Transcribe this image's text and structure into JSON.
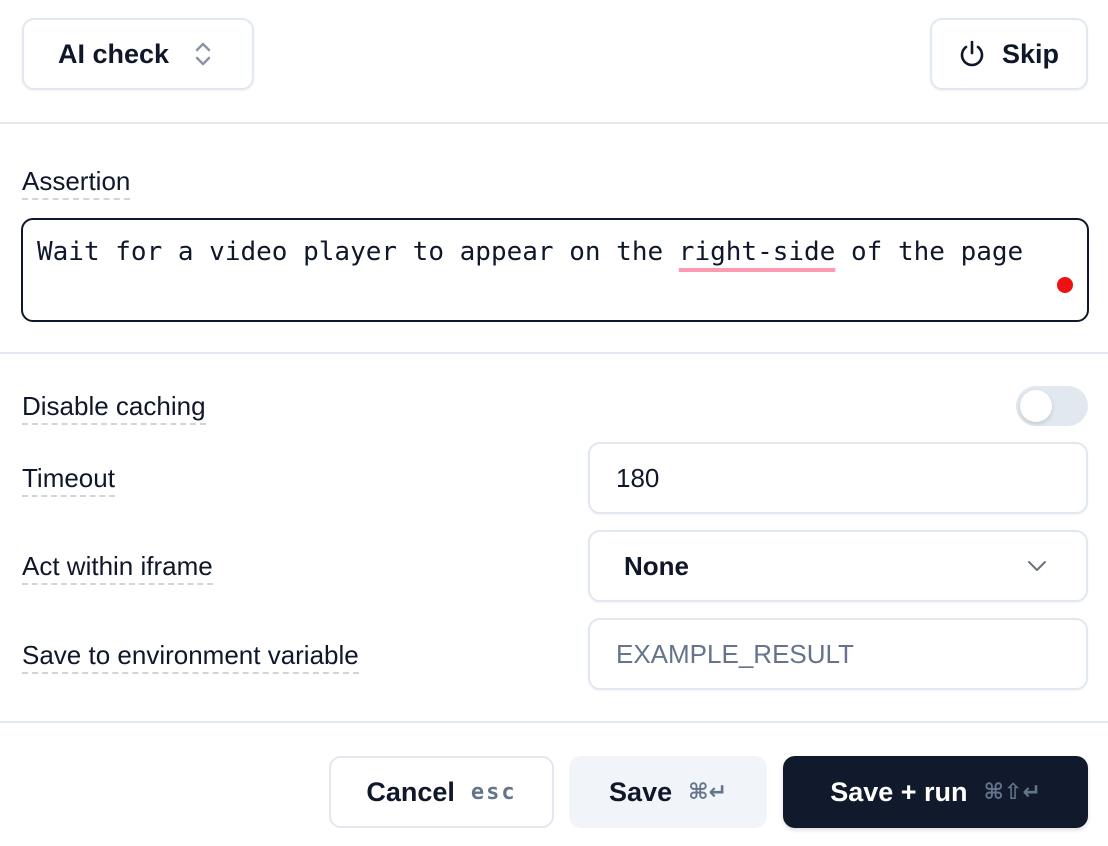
{
  "header": {
    "step_type": {
      "label": "AI check",
      "icon": "chevron-up-down-icon"
    },
    "skip_button": {
      "label": "Skip",
      "icon": "power-icon"
    }
  },
  "assertion": {
    "label": "Assertion",
    "text_before": "Wait for a video player to appear on the ",
    "text_flagged": "right-side",
    "text_after": " of the page",
    "spellcheck_flag_color": "#fb9bb1",
    "status_dot_color": "#ee1111"
  },
  "options": {
    "disable_caching": {
      "label": "Disable caching",
      "enabled": false
    },
    "timeout": {
      "label": "Timeout",
      "value": "180"
    },
    "iframe": {
      "label": "Act within iframe",
      "selected": "None",
      "icon": "chevron-down-icon"
    },
    "env_var": {
      "label": "Save to environment variable",
      "value": "",
      "placeholder": "EXAMPLE_RESULT"
    }
  },
  "footer": {
    "cancel": {
      "label": "Cancel",
      "shortcut": "esc"
    },
    "save": {
      "label": "Save",
      "shortcut": "⌘↵"
    },
    "save_run": {
      "label": "Save + run",
      "shortcut": "⌘⇧↵"
    }
  },
  "colors": {
    "primary_dark": "#111a2c",
    "border": "#e2e8f0",
    "muted_text": "#64748b"
  }
}
